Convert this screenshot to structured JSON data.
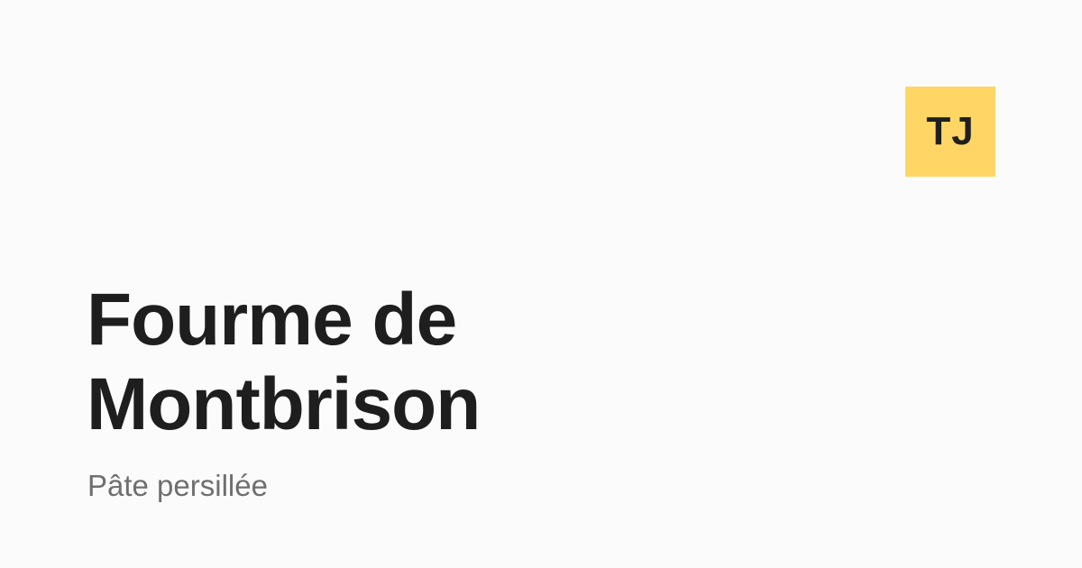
{
  "logo": {
    "text": "TJ",
    "background_color": "#ffd666",
    "text_color": "#1f1f1f"
  },
  "title": {
    "line1": "Fourme de",
    "line2": "Montbrison"
  },
  "subtitle": "Pâte persillée",
  "colors": {
    "background": "#fbfbfb",
    "title": "#1e1e1e",
    "subtitle": "#6f6f6f"
  }
}
